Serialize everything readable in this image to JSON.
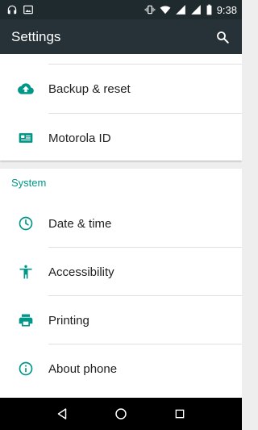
{
  "status_bar": {
    "time": "9:38",
    "icons": [
      "headphones-icon",
      "image-icon",
      "vibrate-icon",
      "wifi-icon",
      "signal-icon",
      "signal-icon",
      "battery-icon"
    ]
  },
  "app_bar": {
    "title": "Settings",
    "search_icon": "search-icon"
  },
  "top_items": [
    {
      "label": "Backup & reset",
      "icon": "cloud-upload-icon"
    },
    {
      "label": "Motorola ID",
      "icon": "id-card-icon"
    }
  ],
  "system_section": {
    "header": "System",
    "items": [
      {
        "label": "Date & time",
        "icon": "clock-icon"
      },
      {
        "label": "Accessibility",
        "icon": "accessibility-icon"
      },
      {
        "label": "Printing",
        "icon": "printer-icon"
      },
      {
        "label": "About phone",
        "icon": "info-icon"
      }
    ]
  },
  "nav_bar": {
    "icons": [
      "back-icon",
      "home-icon",
      "recents-icon"
    ]
  },
  "colors": {
    "accent": "#009688",
    "app_bar": "#263238",
    "status_bar": "#1f2a2e",
    "background": "#eeeeee"
  }
}
